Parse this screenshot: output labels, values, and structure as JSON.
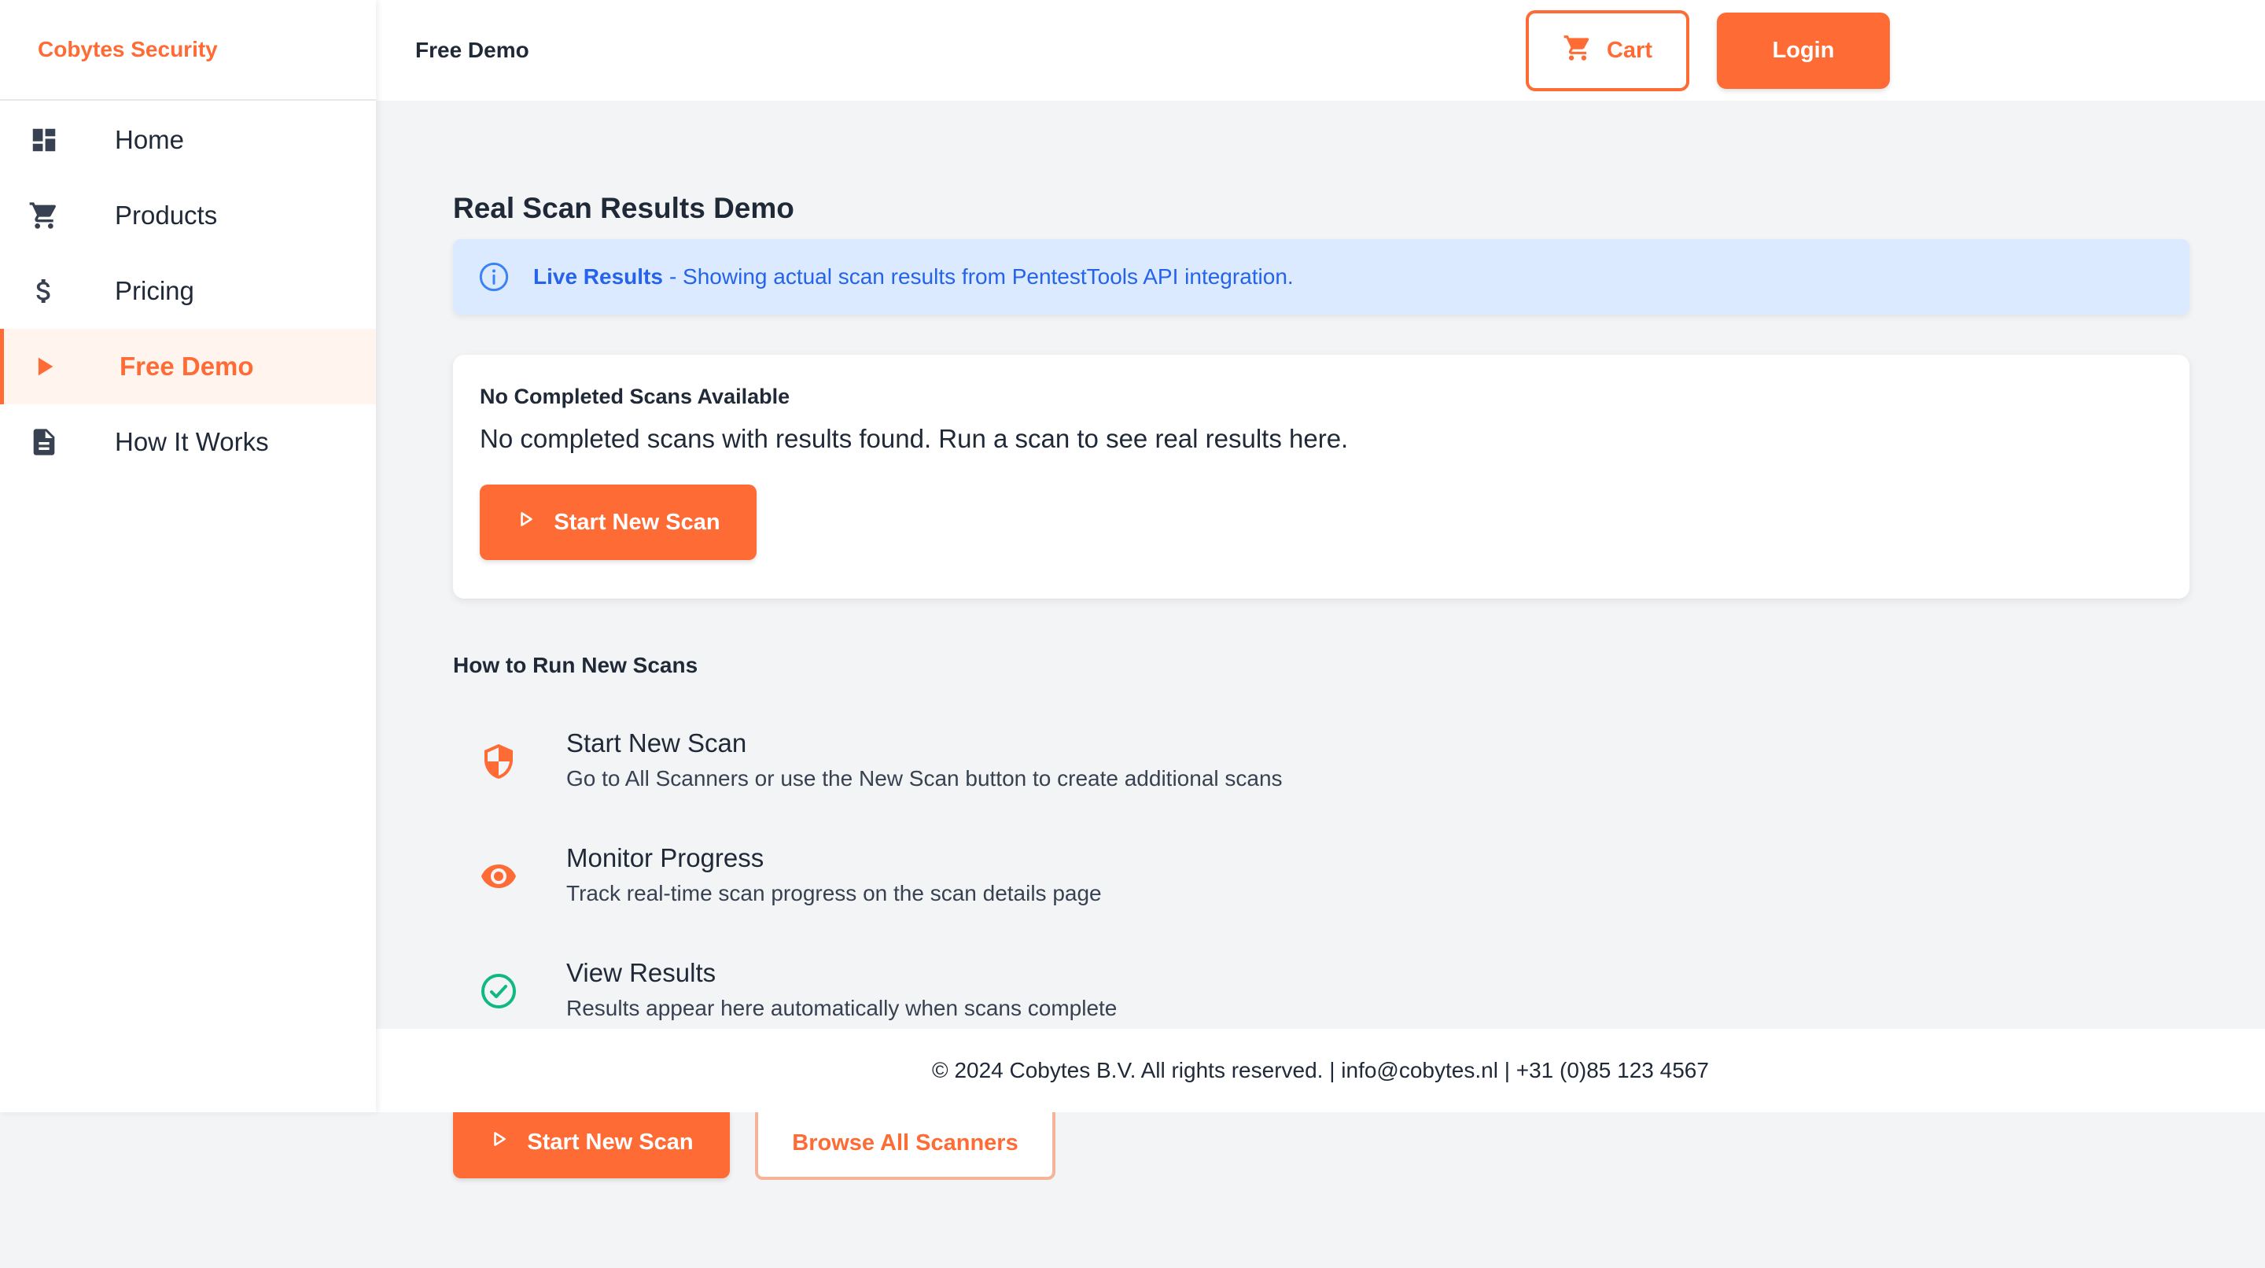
{
  "app": {
    "brand": "Cobytes Security",
    "accent_color": "#ff6b35"
  },
  "sidebar": {
    "items": [
      {
        "label": "Home",
        "icon": "dashboard-icon"
      },
      {
        "label": "Products",
        "icon": "cart-icon"
      },
      {
        "label": "Pricing",
        "icon": "dollar-icon"
      },
      {
        "label": "Free Demo",
        "icon": "play-icon",
        "active": true
      },
      {
        "label": "How It Works",
        "icon": "document-icon"
      }
    ]
  },
  "header": {
    "title": "Free Demo",
    "cart_label": "Cart",
    "login_label": "Login"
  },
  "main": {
    "title": "Real Scan Results Demo",
    "alert": {
      "strong": "Live Results",
      "text": "- Showing actual scan results from PentestTools API integration."
    },
    "empty_card": {
      "title": "No Completed Scans Available",
      "text": "No completed scans with results found. Run a scan to see real results here.",
      "button": "Start New Scan"
    },
    "how_to": {
      "title": "How to Run New Scans",
      "steps": [
        {
          "title": "Start New Scan",
          "desc": "Go to All Scanners or use the New Scan button to create additional scans",
          "icon": "shield-icon"
        },
        {
          "title": "Monitor Progress",
          "desc": "Track real-time scan progress on the scan details page",
          "icon": "eye-icon"
        },
        {
          "title": "View Results",
          "desc": "Results appear here automatically when scans complete",
          "icon": "check-circle-icon"
        }
      ]
    },
    "actions": {
      "start": "Start New Scan",
      "browse": "Browse All Scanners"
    }
  },
  "footer": {
    "text": "© 2024 Cobytes B.V. All rights reserved. | info@cobytes.nl | +31 (0)85 123 4567"
  }
}
